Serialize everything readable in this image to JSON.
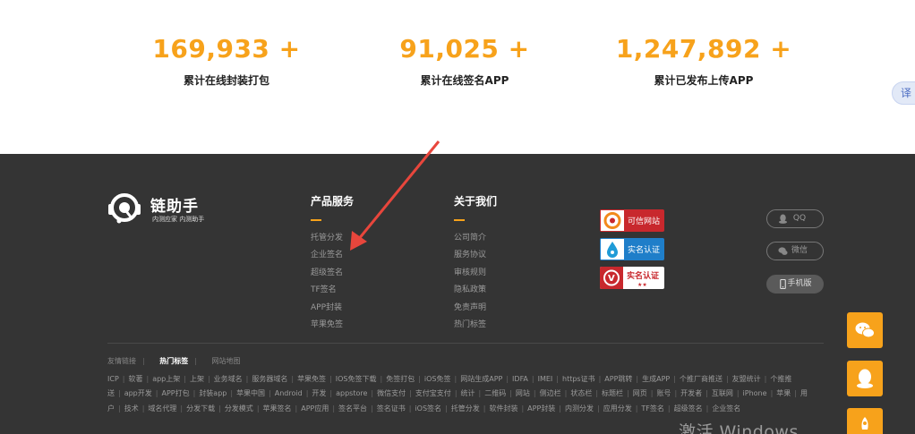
{
  "stats": [
    {
      "value": "169,933 +",
      "label": "累计在线封装打包"
    },
    {
      "value": "91,025 +",
      "label": "累计在线签名APP"
    },
    {
      "value": "1,247,892 +",
      "label": "累计已发布上传APP"
    }
  ],
  "translate_tab": "译",
  "brand": {
    "name": "链助手",
    "subtitle": "内测应家 内测助手"
  },
  "products": {
    "title": "产品服务",
    "items": [
      "托管分发",
      "企业签名",
      "超级签名",
      "TF签名",
      "APP封装",
      "苹果免签"
    ]
  },
  "about": {
    "title": "关于我们",
    "items": [
      "公司简介",
      "服务协议",
      "审核规则",
      "隐私政策",
      "免责声明",
      "热门标签"
    ]
  },
  "badges": [
    {
      "label": "可信网站",
      "color": "#c8282d"
    },
    {
      "label": "实名认证",
      "color": "#1f7ec9"
    },
    {
      "label": "实名认证",
      "color": "#c8282d"
    }
  ],
  "contacts": {
    "qq": "QQ",
    "wechat": "微信",
    "mobile": "手机版"
  },
  "link_tabs": [
    "友情链接",
    "热门标签",
    "网站地图"
  ],
  "hot_links": [
    "ICP",
    "软著",
    "app上架",
    "上架",
    "业务域名",
    "服务器域名",
    "苹果免签",
    "IOS免签下载",
    "免签打包",
    "iOS免签",
    "网站生成APP",
    "IDFA",
    "IMEI",
    "https证书",
    "APP跳转",
    "生成APP",
    "个推厂商推送",
    "友盟统计",
    "个推推送",
    "app开发",
    "APP打包",
    "封装app",
    "苹果中国",
    "Android",
    "开发",
    "appstore",
    "微信支付",
    "支付宝支付",
    "统计",
    "二维码",
    "网站",
    "侧边栏",
    "状态栏",
    "标题栏",
    "网页",
    "账号",
    "开发者",
    "互联网",
    "iPhone",
    "苹果",
    "用户",
    "技术",
    "域名代理",
    "分发下载",
    "分发模式",
    "苹果签名",
    "APP应用",
    "签名平台",
    "签名证书",
    "iOS签名",
    "托管分发",
    "软件封装",
    "APP封装",
    "内测分发",
    "应用分发",
    "TF签名",
    "超级签名",
    "企业签名"
  ],
  "watermark": "激活 Windows",
  "colors": {
    "accent": "#f7a21b",
    "footer_bg": "#343434"
  }
}
